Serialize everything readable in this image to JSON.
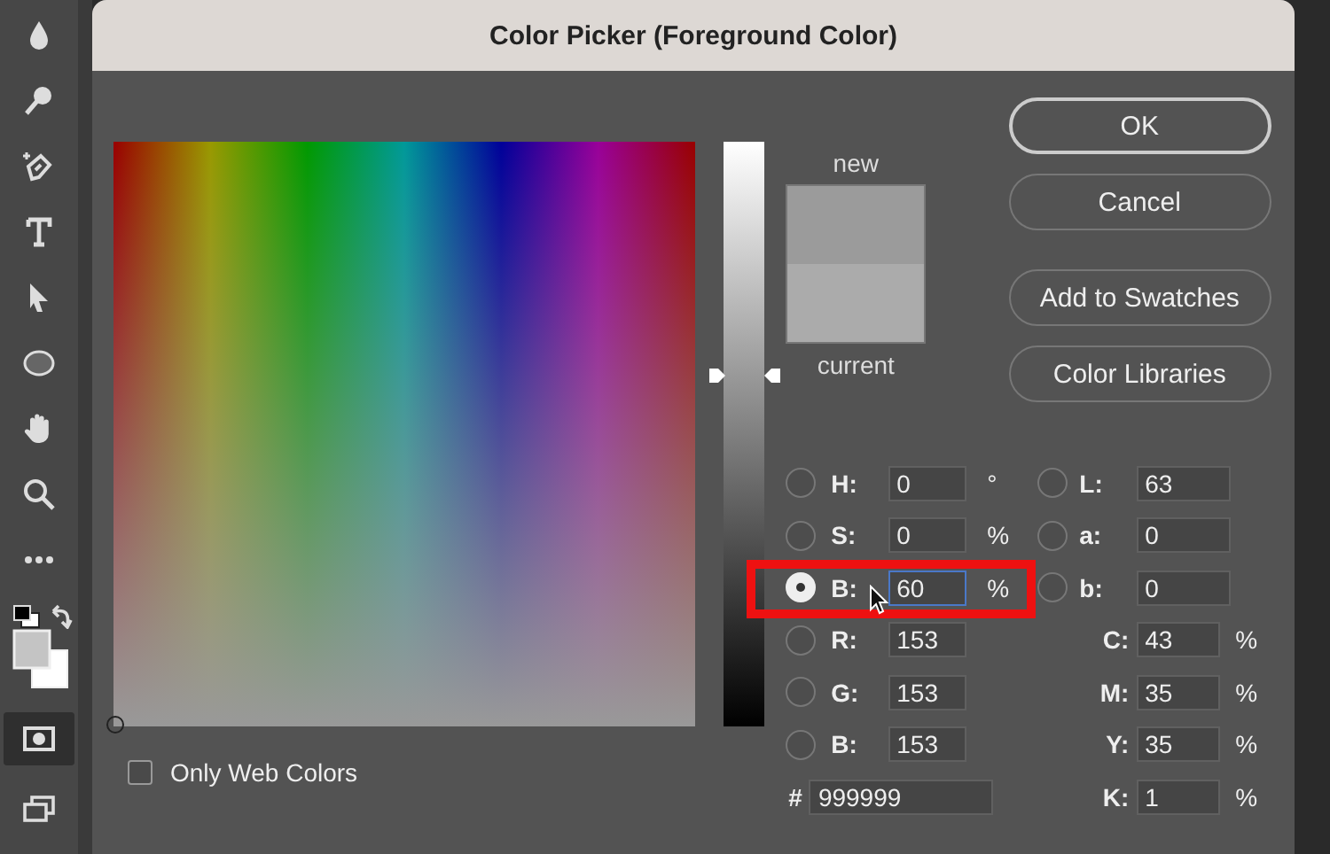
{
  "toolbar": {
    "tools": [
      {
        "kind": "drop",
        "selected": false
      },
      {
        "kind": "dodge",
        "selected": false
      },
      {
        "kind": "pen",
        "selected": false
      },
      {
        "kind": "type",
        "selected": false
      },
      {
        "kind": "select",
        "selected": false
      },
      {
        "kind": "ellipse",
        "selected": false
      },
      {
        "kind": "hand",
        "selected": false
      },
      {
        "kind": "zoom",
        "selected": false
      },
      {
        "kind": "more",
        "selected": false
      }
    ],
    "modes": [
      {
        "kind": "mask",
        "selected": true
      },
      {
        "kind": "screen",
        "selected": false
      }
    ]
  },
  "dialog": {
    "title": "Color Picker (Foreground Color)",
    "hue_slider": {
      "level": 0.6
    },
    "swatch": {
      "new_label": "new",
      "current_label": "current"
    },
    "buttons": [
      {
        "label": "OK",
        "default": true
      },
      {
        "label": "Cancel",
        "default": false
      },
      {
        "label": "Add to Swatches",
        "default": false
      },
      {
        "label": "Color Libraries",
        "default": false
      }
    ],
    "hsb_rgb_fields": [
      {
        "label": "H:",
        "value": "0",
        "unit": "°",
        "selected": false,
        "focused": false
      },
      {
        "label": "S:",
        "value": "0",
        "unit": "%",
        "selected": false,
        "focused": false
      },
      {
        "label": "B:",
        "value": "60",
        "unit": "%",
        "selected": true,
        "focused": true
      },
      {
        "label": "R:",
        "value": "153",
        "selected": false,
        "focused": false
      },
      {
        "label": "G:",
        "value": "153",
        "selected": false,
        "focused": false
      },
      {
        "label": "B:",
        "value": "153",
        "selected": false,
        "focused": false
      }
    ],
    "lab_fields": [
      {
        "label": "L:",
        "value": "63",
        "selected": false
      },
      {
        "label": "a:",
        "value": "0",
        "selected": false
      },
      {
        "label": "b:",
        "value": "0",
        "selected": false
      }
    ],
    "cmyk_fields": [
      {
        "label": "C:",
        "value": "43",
        "unit": "%"
      },
      {
        "label": "M:",
        "value": "35",
        "unit": "%"
      },
      {
        "label": "Y:",
        "value": "35",
        "unit": "%"
      },
      {
        "label": "K:",
        "value": "1",
        "unit": "%"
      }
    ],
    "hex": {
      "label": "#",
      "value": "999999"
    },
    "only_web_colors": {
      "label": "Only Web Colors",
      "checked": false
    }
  }
}
